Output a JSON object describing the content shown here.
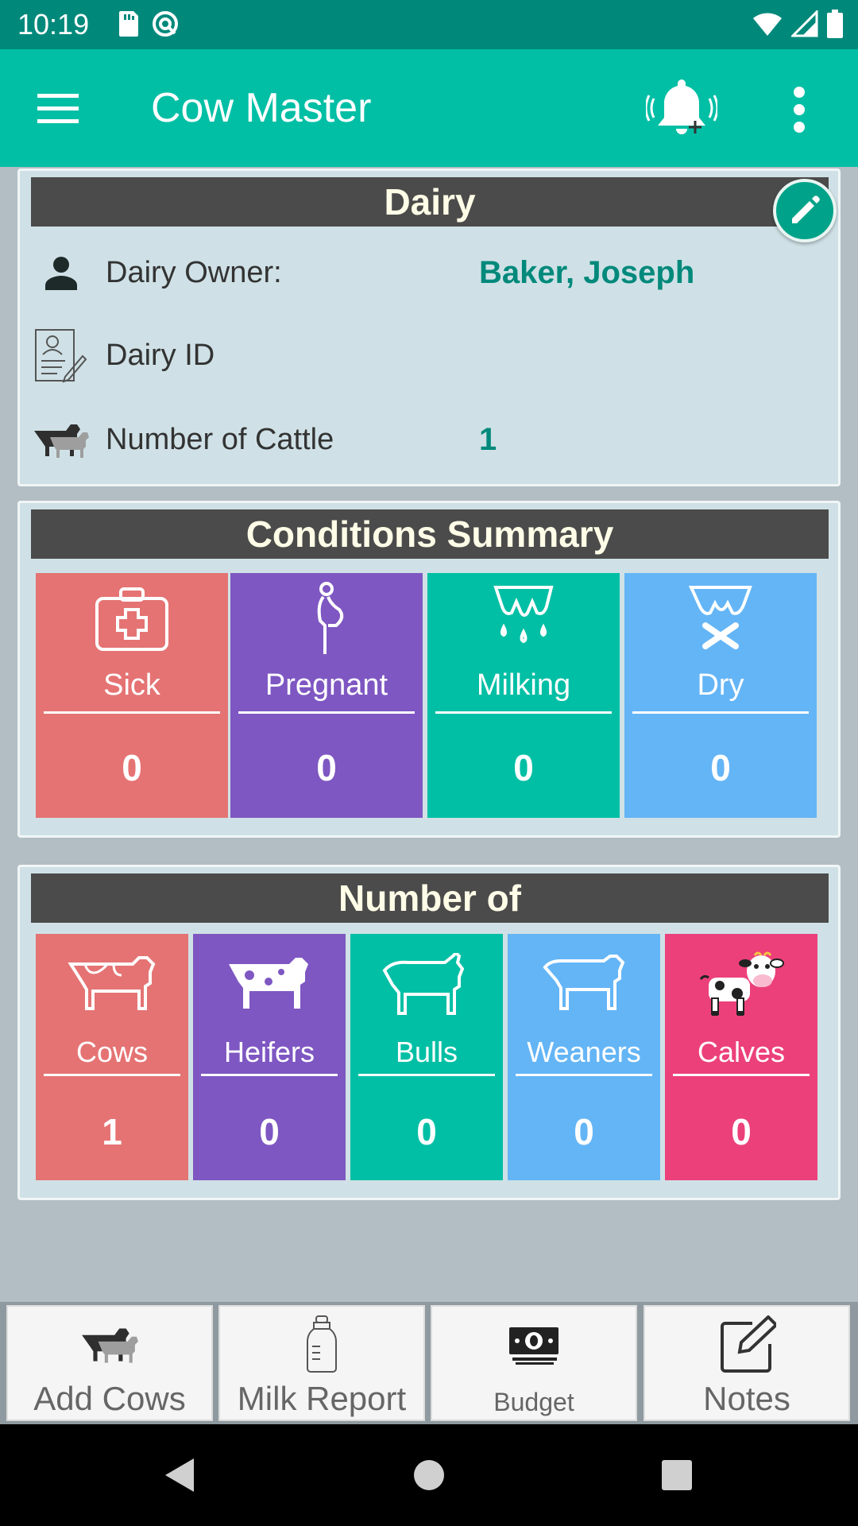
{
  "status_bar": {
    "time": "10:19"
  },
  "app_bar": {
    "title": "Cow Master"
  },
  "dairy": {
    "header": "Dairy",
    "owner_label": "Dairy Owner:",
    "owner_value": "Baker, Joseph",
    "id_label": "Dairy ID",
    "id_value": "",
    "cattle_label": "Number of Cattle",
    "cattle_value": "1"
  },
  "conditions": {
    "header": "Conditions Summary",
    "tiles": [
      {
        "label": "Sick",
        "count": "0",
        "color": "#e57373",
        "icon": "first-aid-kit-icon"
      },
      {
        "label": "Pregnant",
        "count": "0",
        "color": "#7e57c2",
        "icon": "pregnant-icon"
      },
      {
        "label": "Milking",
        "count": "0",
        "color": "#00bfa5",
        "icon": "udder-milk-drops-icon"
      },
      {
        "label": "Dry",
        "count": "0",
        "color": "#64b5f6",
        "icon": "udder-crossed-icon"
      }
    ]
  },
  "number_of": {
    "header": "Number of",
    "tiles": [
      {
        "label": "Cows",
        "count": "1",
        "color": "#e57373",
        "icon": "cow-icon"
      },
      {
        "label": "Heifers",
        "count": "0",
        "color": "#7e57c2",
        "icon": "heifer-icon"
      },
      {
        "label": "Bulls",
        "count": "0",
        "color": "#00bfa5",
        "icon": "bull-icon"
      },
      {
        "label": "Weaners",
        "count": "0",
        "color": "#64b5f6",
        "icon": "weaner-icon"
      },
      {
        "label": "Calves",
        "count": "0",
        "color": "#ec407a",
        "icon": "calf-icon"
      }
    ]
  },
  "bottom_buttons": [
    {
      "label": "Add Cows",
      "icon": "cattle-icon"
    },
    {
      "label": "Milk Report",
      "icon": "milk-bottle-icon"
    },
    {
      "label": "Budget",
      "icon": "money-icon"
    },
    {
      "label": "Notes",
      "icon": "edit-note-icon"
    }
  ],
  "colors": {
    "status_bar": "#00897b",
    "app_bar": "#00bfa5",
    "accent": "#00897b",
    "header_bg": "#4b4b4b"
  }
}
